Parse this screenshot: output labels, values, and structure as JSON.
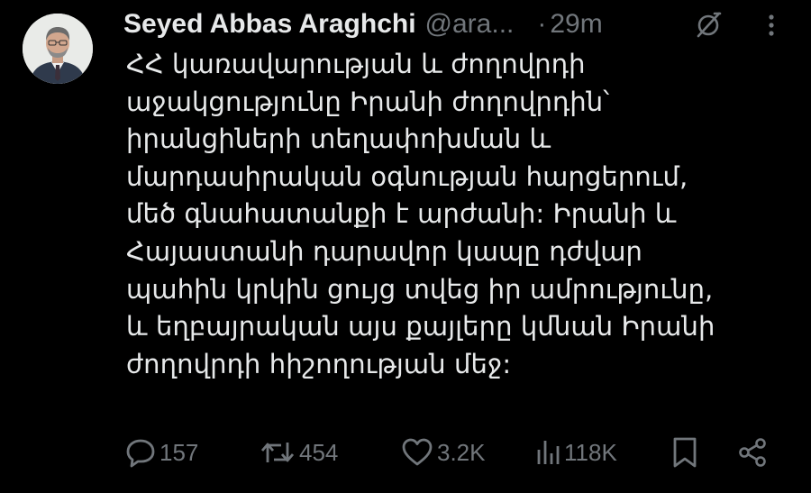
{
  "author": {
    "name": "Seyed Abbas Araghchi",
    "handle": "@ara...",
    "separator": "·",
    "time": "29m"
  },
  "tweet": {
    "text": "ՀՀ կառավարության և ժողովրդի\nաջակցությունը Իրանի ժողովրդին՝\nիրանցիների տեղափոխման և\nմարդասիրական օգնության հարցերում,\nմեծ գնահատանքի է արժանի: Իրանի և\nՀայաստանի դարավոր կապը դժվար\nպահին կրկին ցույց տվեց իր ամրությունը,\nև եղբայրական այս քայլերը կմնան Իրանի\nժողովրդի հիշողության մեջ:"
  },
  "actions": {
    "reply_count": "157",
    "retweet_count": "454",
    "like_count": "3.2K",
    "view_count": "118K"
  },
  "icons": {
    "avatar": "profile-photo",
    "header": [
      "grok-icon",
      "more-icon"
    ],
    "actions": [
      "reply-icon",
      "retweet-icon",
      "like-icon",
      "views-icon",
      "bookmark-icon",
      "share-icon"
    ]
  },
  "colors": {
    "background": "#000000",
    "primary_text": "#e7e9ea",
    "secondary_text": "#71767b"
  }
}
